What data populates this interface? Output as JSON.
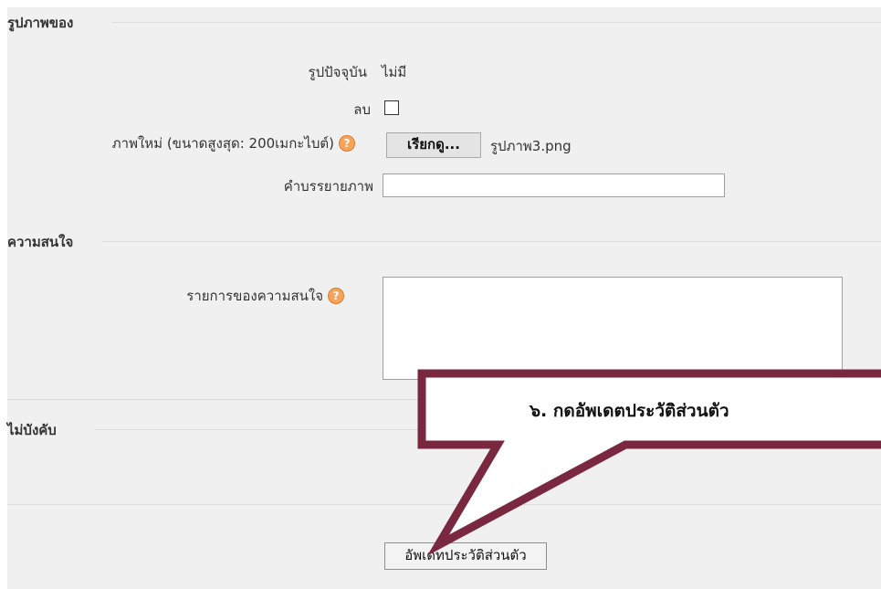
{
  "picture_section": {
    "heading": "รูปภาพของ",
    "current_picture_label": "รูปปัจจุบัน",
    "current_picture_value": "ไม่มี",
    "delete_label": "ลบ",
    "delete_checked": false,
    "new_picture_label": "ภาพใหม่ (ขนาดสูงสุด: 200เมกะไบต์)",
    "browse_button": "เรียกดู...",
    "selected_file": "รูปภาพ3.png",
    "description_label": "คำบรรยายภาพ",
    "description_value": ""
  },
  "interests_section": {
    "heading": "ความสนใจ",
    "interests_label": "รายการของความสนใจ",
    "interests_value": ""
  },
  "optional_section": {
    "heading": "ไม่บังคับ"
  },
  "submit_button": "อัพเดทประวัติส่วนตัว",
  "callout": {
    "text": "๖. กดอัพเดตประวัติส่วนตัว",
    "color": "#7a2840"
  },
  "icons": {
    "help": "help-icon"
  }
}
